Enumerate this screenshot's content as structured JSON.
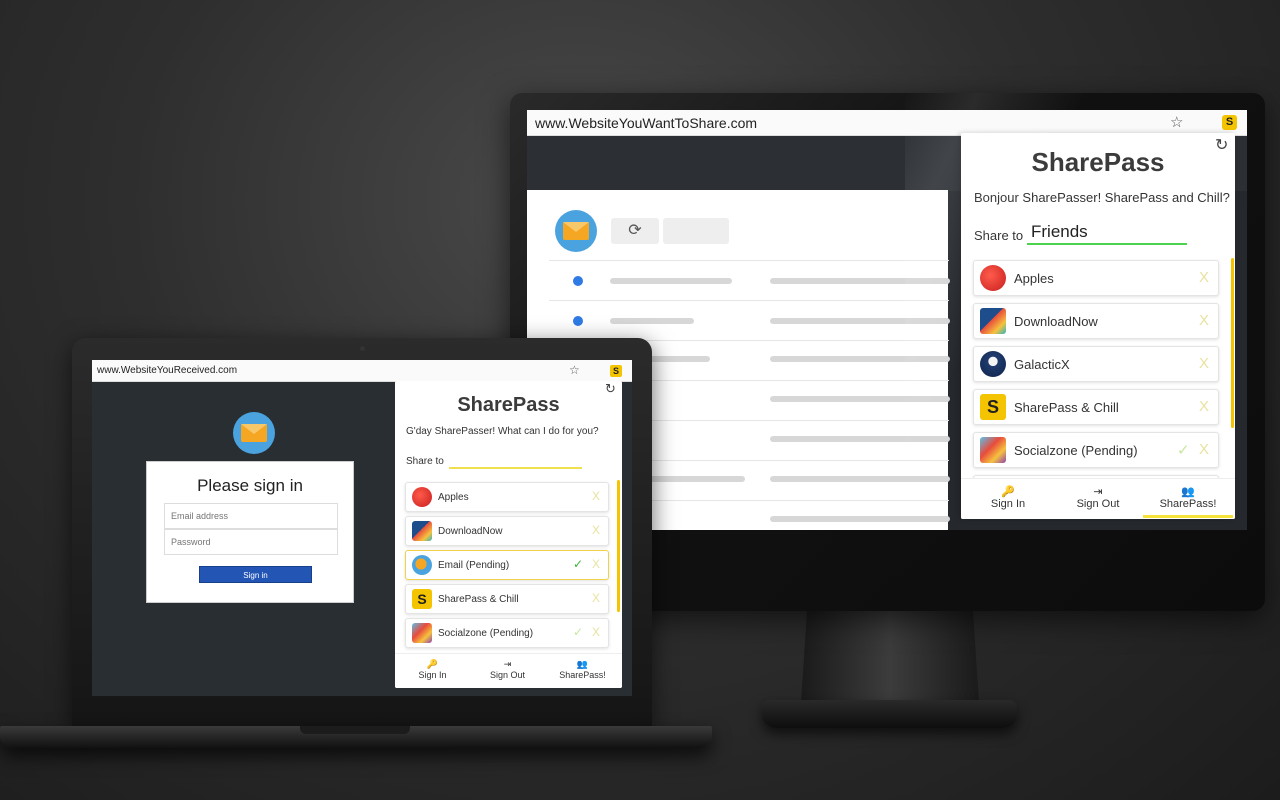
{
  "monitor": {
    "browser": {
      "url": "www.WebsiteYouWantToShare.com",
      "star_icon": "☆",
      "extension_icon": "S"
    },
    "page": {
      "refresh_icon": "⟳"
    },
    "popup": {
      "title": "SharePass",
      "refresh_icon": "↻",
      "greeting": "Bonjour SharePasser! SharePass and Chill?",
      "share_to_label": "Share to",
      "share_to_value": "Friends",
      "items": [
        {
          "label": "Apples",
          "icon": "apple-icon",
          "status": "",
          "remove": "X"
        },
        {
          "label": "DownloadNow",
          "icon": "downloadnow-icon",
          "status": "",
          "remove": "X"
        },
        {
          "label": "GalacticX",
          "icon": "rocket-icon",
          "status": "",
          "remove": "X"
        },
        {
          "label": "SharePass & Chill",
          "icon": "sharepass-logo-icon",
          "status": "",
          "remove": "X"
        },
        {
          "label": "Socialzone (Pending)",
          "icon": "socialzone-icon",
          "status": "✓",
          "remove": "X"
        }
      ],
      "nav": [
        {
          "label": "Sign In",
          "icon": "🔑"
        },
        {
          "label": "Sign Out",
          "icon": "⇥"
        },
        {
          "label": "SharePass!",
          "icon": "👥"
        }
      ]
    }
  },
  "laptop": {
    "browser": {
      "url": "www.WebsiteYouReceived.com",
      "star_icon": "☆",
      "extension_icon": "S"
    },
    "signin_card": {
      "title": "Please sign in",
      "email_placeholder": "Email address",
      "password_placeholder": "Password",
      "button_label": "Sign in"
    },
    "popup": {
      "title": "SharePass",
      "refresh_icon": "↻",
      "greeting": "G'day SharePasser! What can I do for you?",
      "share_to_label": "Share to",
      "share_to_value": "",
      "items": [
        {
          "label": "Apples",
          "icon": "apple-icon",
          "status": "",
          "remove": "X"
        },
        {
          "label": "DownloadNow",
          "icon": "downloadnow-icon",
          "status": "",
          "remove": "X"
        },
        {
          "label": "Email (Pending)",
          "icon": "email-icon",
          "status": "✓",
          "remove": "X"
        },
        {
          "label": "SharePass & Chill",
          "icon": "sharepass-logo-icon",
          "status": "",
          "remove": "X"
        },
        {
          "label": "Socialzone (Pending)",
          "icon": "socialzone-icon",
          "status": "✓",
          "remove": "X"
        }
      ],
      "nav": [
        {
          "label": "Sign In",
          "icon": "🔑"
        },
        {
          "label": "Sign Out",
          "icon": "⇥"
        },
        {
          "label": "SharePass!",
          "icon": "👥"
        }
      ]
    }
  },
  "colors": {
    "accent_yellow": "#f5c400",
    "check_green": "#3bb33b",
    "signin_blue": "#2355b4",
    "bullet_blue": "#2f7ae5"
  }
}
